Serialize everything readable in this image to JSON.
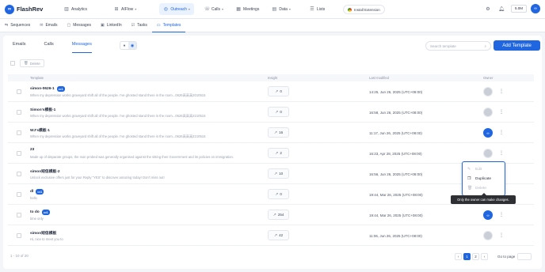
{
  "brand": {
    "name": "FlashRev",
    "mark": "∞"
  },
  "topnav": {
    "items": [
      {
        "label": "Analytics",
        "icon": "bar-chart-icon",
        "glyph": "▥",
        "caret": false
      },
      {
        "label": "AIFlow",
        "icon": "flow-icon",
        "glyph": "⊞",
        "caret": true
      },
      {
        "label": "Outreach",
        "icon": "send-icon",
        "glyph": "◎",
        "caret": true
      },
      {
        "label": "Calls",
        "icon": "phone-icon",
        "glyph": "☏",
        "caret": true
      },
      {
        "label": "Meetings",
        "icon": "calendar-icon",
        "glyph": "▦",
        "caret": false
      },
      {
        "label": "Data",
        "icon": "database-icon",
        "glyph": "▤",
        "caret": true
      },
      {
        "label": "Lists",
        "icon": "list-icon",
        "glyph": "☰",
        "caret": false
      }
    ],
    "install_extension": "Install Extension",
    "credit": "5.0M",
    "avatar_initials": "∞"
  },
  "subnav": {
    "items": [
      {
        "label": "Sequences",
        "glyph": "⇆"
      },
      {
        "label": "Emails",
        "glyph": "✉"
      },
      {
        "label": "Messages",
        "glyph": "▢"
      },
      {
        "label": "LinkedIn",
        "glyph": "▣"
      },
      {
        "label": "Tasks",
        "glyph": "☑"
      },
      {
        "label": "Templates",
        "glyph": "▭"
      }
    ]
  },
  "tabs": [
    "Emails",
    "Calls",
    "Messages"
  ],
  "search": {
    "placeholder": "Search template"
  },
  "add_button": "Add Template",
  "delete_button": "Delete",
  "table": {
    "headers": {
      "template": "Template",
      "insight": "Insight",
      "modified": "Last modified",
      "owner": "Owner"
    },
    "rows": [
      {
        "name": "simon-0626-1",
        "badge": "1",
        "preview": "When my depression works graveyard shift all of the people. I've ghosted stand there in the room...0626高高高2010515",
        "insight": "0",
        "modified": "14:25, Jun 26, 2025 (UTC+08:00)",
        "owner": "other"
      },
      {
        "name": "Simon's模板-1",
        "badge": "",
        "preview": "When my depression works graveyard shift all of the people. I've ghosted stand there in the room...0626高高高2210515",
        "insight": "0",
        "modified": "16:58, Jun 26, 2025 (UTC+08:00)",
        "owner": "other"
      },
      {
        "name": "WJ's模板-1",
        "badge": "",
        "preview": "When my depression works graveyard shift all of the people. I've ghosted stand there in the room...0626高高高2210515",
        "insight": "16",
        "modified": "11:17, Jun 26, 2025 (UTC+08:00)",
        "owner": "self"
      },
      {
        "name": "23",
        "badge": "",
        "preview": "Made up of disparate groups, the man probed was generally organised against the sitting then Government and its policies on immigration.",
        "insight": "2",
        "modified": "16:23, Apr 28, 2025 (UTC+08:00)",
        "owner": "other"
      },
      {
        "name": "simon短信模板-2",
        "badge": "",
        "preview": "Unlock exclusive offers just for you! Reply \"YES\" to discover amazing today! Don't miss out!",
        "insight": "10",
        "modified": "16:56, Jun 26, 2025 (UTC+08:00)",
        "owner": "other"
      },
      {
        "name": "dl",
        "badge": "1",
        "preview": "hello",
        "insight": "0",
        "modified": "19:44, Mar 26, 2025 (UTC+08:00)",
        "owner": "other"
      },
      {
        "name": "to do",
        "badge": "1",
        "preview": "time only",
        "insight": "254",
        "modified": "19:44, Mar 26, 2025 (UTC+08:00)",
        "owner": "self"
      },
      {
        "name": "simon短信模板",
        "badge": "",
        "preview": "Hi, nice to meet you to",
        "insight": "42",
        "modified": "11:06, Jun 26, 2025 (UTC+08:00)",
        "owner": "other"
      }
    ]
  },
  "context_menu": {
    "edit": "Edit",
    "duplicate": "Duplicate",
    "delete": "Delete"
  },
  "tooltip": "Only the owner can make changes.",
  "footer": {
    "total": "1 - 10 of 20",
    "pages": [
      "1",
      "2"
    ],
    "goto_label": "Go to page"
  },
  "colors": {
    "primary": "#1f66e0",
    "background": "#f3f5f9"
  }
}
